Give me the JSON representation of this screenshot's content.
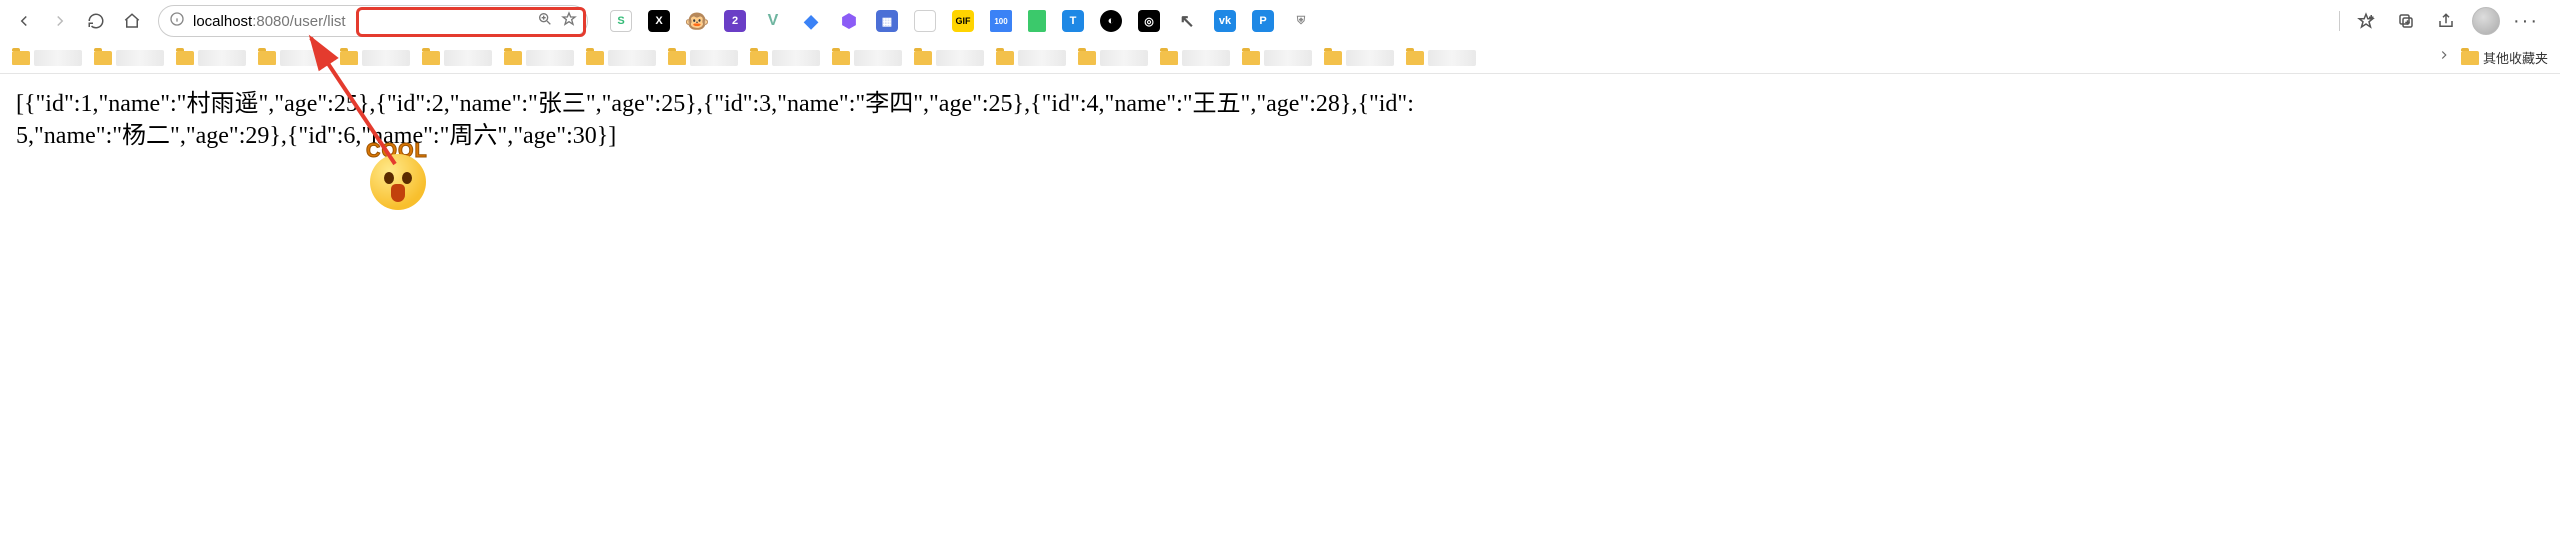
{
  "nav": {
    "url_host": "localhost",
    "url_portpath": ":8080/user/list"
  },
  "extensions": {
    "s_label": "S",
    "x_label": "X",
    "monkey": "🐵",
    "badge2": "2",
    "v_label": "V",
    "cube": "◆",
    "purplebox": "⬢",
    "grid": "▦",
    "gif": "GIF",
    "cal": "100",
    "t": "T",
    "yin": "◐",
    "swirl": "◎",
    "cursor": "↖",
    "vk": "vk",
    "p": "P",
    "shield": "⛨"
  },
  "bookmarks": {
    "other_label": "其他收藏夹"
  },
  "content": {
    "body_text": "[{\"id\":1,\"name\":\"村雨遥\",\"age\":25},{\"id\":2,\"name\":\"张三\",\"age\":25},{\"id\":3,\"name\":\"李四\",\"age\":25},{\"id\":4,\"name\":\"王五\",\"age\":28},{\"id\":5,\"name\":\"杨二\",\"age\":29},{\"id\":6,\"name\":\"周六\",\"age\":30}]"
  },
  "sticker": {
    "cool_text": "COOL"
  }
}
